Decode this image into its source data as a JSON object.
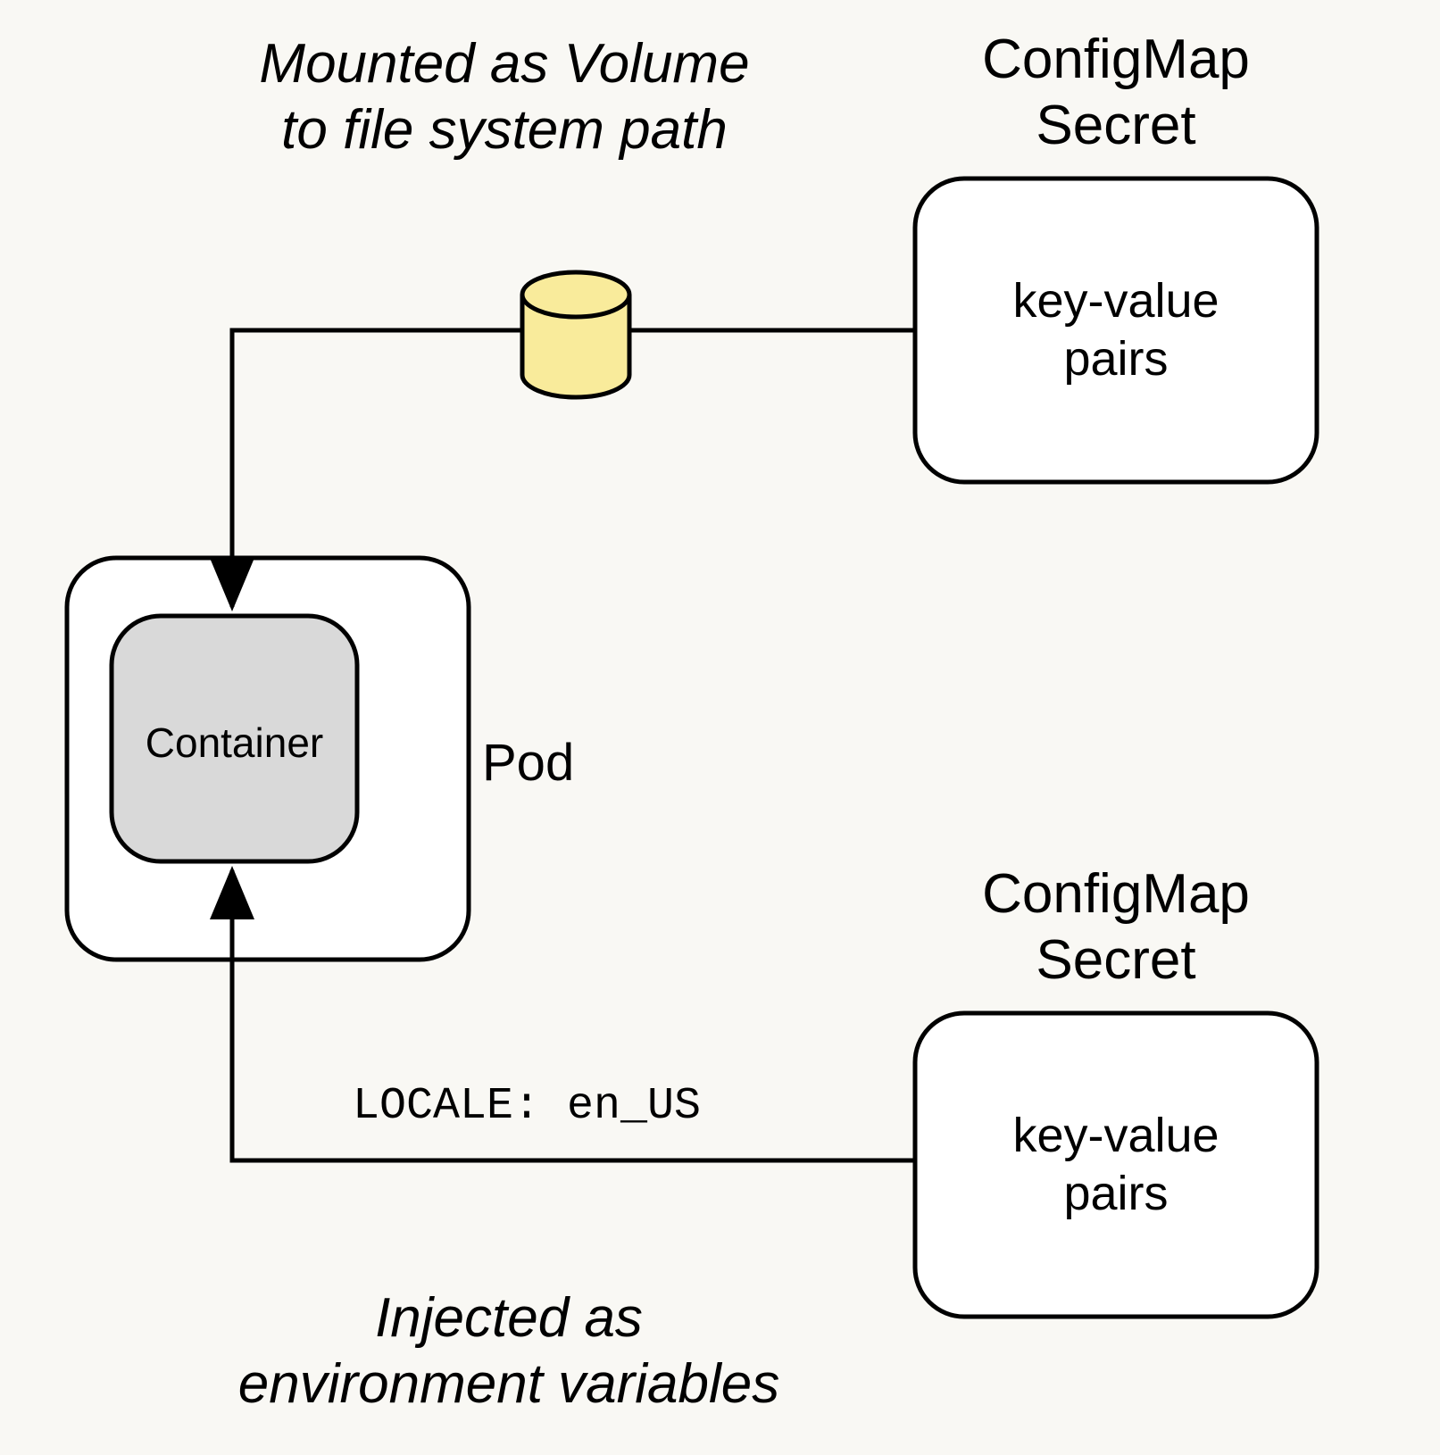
{
  "caption_top": "Mounted as Volume\nto file system path",
  "caption_bottom": "Injected as\nenvironment variables",
  "configmap_top": {
    "title": "ConfigMap\nSecret",
    "content": "key-value\npairs"
  },
  "configmap_bottom": {
    "title": "ConfigMap\nSecret",
    "content": "key-value\npairs"
  },
  "pod": {
    "label": "Pod",
    "container_label": "Container"
  },
  "env_example": "LOCALE: en_US"
}
